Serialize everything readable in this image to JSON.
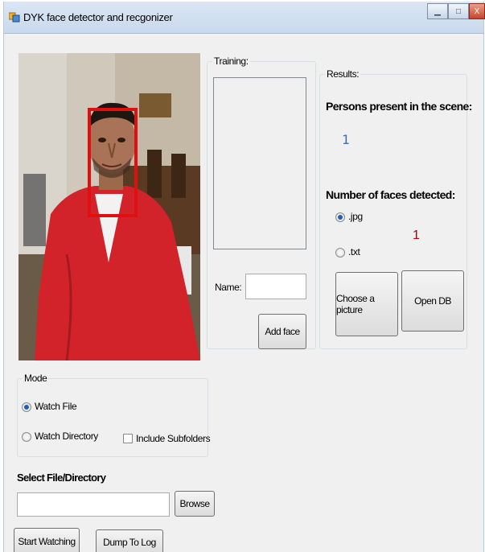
{
  "window": {
    "title": "DYK face detector and recgonizer",
    "minimize": "▁",
    "maximize": "□",
    "close": "X"
  },
  "training": {
    "label": "Training:",
    "name_label": "Name:",
    "name_value": "",
    "add_face_button": "Add face"
  },
  "results": {
    "label": "Results:",
    "persons_label": "Persons present in the scene:",
    "persons_value": "1",
    "faces_label": "Number of faces detected:",
    "faces_value": "1",
    "options": [
      {
        "label": ".jpg",
        "checked": true
      },
      {
        "label": ".txt",
        "checked": false
      }
    ],
    "choose_button": "Choose a picture",
    "open_db_button": "Open DB"
  },
  "mode": {
    "label": "Mode",
    "options": [
      {
        "label": "Watch File",
        "checked": true
      },
      {
        "label": "Watch Directory",
        "checked": false
      }
    ],
    "include_subfolders": "Include Subfolders",
    "include_subfolders_checked": false
  },
  "select": {
    "label": "Select File/Directory",
    "path_value": "",
    "browse_button": "Browse"
  },
  "actions": {
    "start_button": "Start Watching",
    "dump_button": "Dump To Log"
  },
  "detection": {
    "box_color": "#e01010",
    "face_count": 1
  },
  "colors": {
    "persons_value": "#3a6fb5",
    "faces_value": "#b40000"
  }
}
